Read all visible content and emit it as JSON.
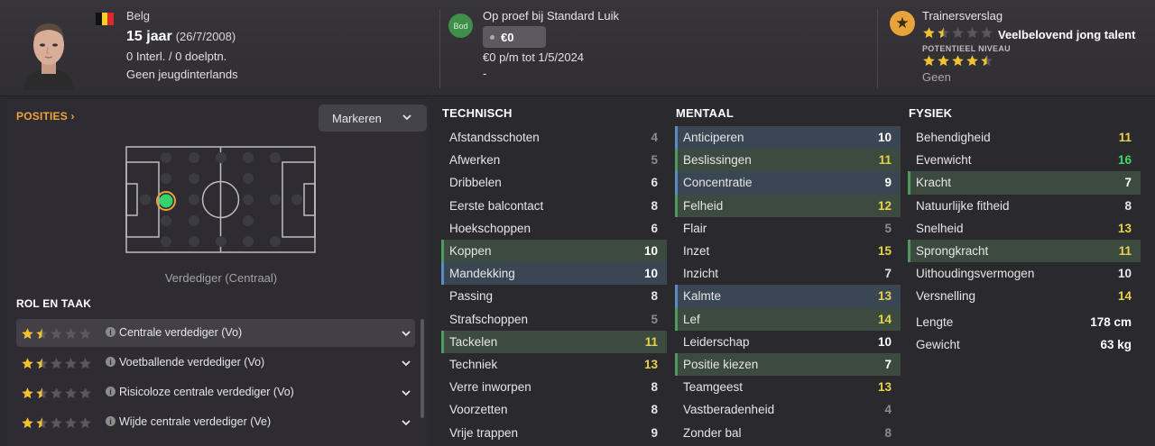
{
  "header": {
    "nationality": "Belg",
    "flag_colors": [
      "#111111",
      "#f5d21f",
      "#e0262b"
    ],
    "age": "15 jaar",
    "birthdate": "(26/7/2008)",
    "caps": "0 Interl. / 0 doelptn.",
    "youth_caps": "Geen jeugdinterlands",
    "bid_badge": "Bod",
    "status": "Op proef bij Standard Luik",
    "fee": "€0",
    "wage": "€0 p/m tot 1/5/2024",
    "dash": "-",
    "report_title": "Trainersverslag",
    "current_stars": 1.5,
    "verdict": "Veelbelovend jong talent",
    "potential_label": "POTENTIEEL NIVEAU",
    "potential_stars": 4.5,
    "potential_note": "Geen"
  },
  "positions": {
    "title": "POSITIES",
    "title_icon": "chevron-right-icon",
    "mark_button": "Markeren",
    "caption": "Verdediger (Centraal)"
  },
  "roles": {
    "title": "ROL EN TAAK",
    "items": [
      {
        "label": "Centrale verdediger (Vo)",
        "stars": 1.5,
        "selected": true
      },
      {
        "label": "Voetballende verdediger (Vo)",
        "stars": 1.5,
        "selected": false
      },
      {
        "label": "Risicoloze centrale verdediger (Vo)",
        "stars": 1.5,
        "selected": false
      },
      {
        "label": "Wijde centrale verdediger (Ve)",
        "stars": 1.5,
        "selected": false
      }
    ]
  },
  "technical": {
    "title": "TECHNISCH",
    "attrs": [
      {
        "name": "Afstandsschoten",
        "value": "4",
        "color": "#8c8c8c",
        "hl": ""
      },
      {
        "name": "Afwerken",
        "value": "5",
        "color": "#8c8c8c",
        "hl": ""
      },
      {
        "name": "Dribbelen",
        "value": "6",
        "color": "#e6e6e6",
        "hl": ""
      },
      {
        "name": "Eerste balcontact",
        "value": "8",
        "color": "#e6e6e6",
        "hl": ""
      },
      {
        "name": "Hoekschoppen",
        "value": "6",
        "color": "#e6e6e6",
        "hl": ""
      },
      {
        "name": "Koppen",
        "value": "10",
        "color": "#ffffff",
        "hl": "green"
      },
      {
        "name": "Mandekking",
        "value": "10",
        "color": "#ffffff",
        "hl": "blue"
      },
      {
        "name": "Passing",
        "value": "8",
        "color": "#e6e6e6",
        "hl": ""
      },
      {
        "name": "Strafschoppen",
        "value": "5",
        "color": "#8c8c8c",
        "hl": ""
      },
      {
        "name": "Tackelen",
        "value": "11",
        "color": "#e8d44a",
        "hl": "green"
      },
      {
        "name": "Techniek",
        "value": "13",
        "color": "#e8d44a",
        "hl": ""
      },
      {
        "name": "Verre inworpen",
        "value": "8",
        "color": "#e6e6e6",
        "hl": ""
      },
      {
        "name": "Voorzetten",
        "value": "8",
        "color": "#e6e6e6",
        "hl": ""
      },
      {
        "name": "Vrije trappen",
        "value": "9",
        "color": "#e6e6e6",
        "hl": ""
      }
    ]
  },
  "mental": {
    "title": "MENTAAL",
    "attrs": [
      {
        "name": "Anticiperen",
        "value": "10",
        "color": "#ffffff",
        "hl": "blue"
      },
      {
        "name": "Beslissingen",
        "value": "11",
        "color": "#e8d44a",
        "hl": "green"
      },
      {
        "name": "Concentratie",
        "value": "9",
        "color": "#ffffff",
        "hl": "blue"
      },
      {
        "name": "Felheid",
        "value": "12",
        "color": "#e8d44a",
        "hl": "green"
      },
      {
        "name": "Flair",
        "value": "5",
        "color": "#8c8c8c",
        "hl": ""
      },
      {
        "name": "Inzet",
        "value": "15",
        "color": "#e8d44a",
        "hl": ""
      },
      {
        "name": "Inzicht",
        "value": "7",
        "color": "#e6e6e6",
        "hl": ""
      },
      {
        "name": "Kalmte",
        "value": "13",
        "color": "#e8d44a",
        "hl": "blue"
      },
      {
        "name": "Lef",
        "value": "14",
        "color": "#e8d44a",
        "hl": "green"
      },
      {
        "name": "Leiderschap",
        "value": "10",
        "color": "#ffffff",
        "hl": ""
      },
      {
        "name": "Positie kiezen",
        "value": "7",
        "color": "#ffffff",
        "hl": "green"
      },
      {
        "name": "Teamgeest",
        "value": "13",
        "color": "#e8d44a",
        "hl": ""
      },
      {
        "name": "Vastberadenheid",
        "value": "4",
        "color": "#8c8c8c",
        "hl": ""
      },
      {
        "name": "Zonder bal",
        "value": "8",
        "color": "#8c8c8c",
        "hl": ""
      }
    ]
  },
  "physical": {
    "title": "FYSIEK",
    "attrs": [
      {
        "name": "Behendigheid",
        "value": "11",
        "color": "#e8d44a",
        "hl": ""
      },
      {
        "name": "Evenwicht",
        "value": "16",
        "color": "#3fd66a",
        "hl": ""
      },
      {
        "name": "Kracht",
        "value": "7",
        "color": "#ffffff",
        "hl": "green"
      },
      {
        "name": "Natuurlijke fitheid",
        "value": "8",
        "color": "#e6e6e6",
        "hl": ""
      },
      {
        "name": "Snelheid",
        "value": "13",
        "color": "#e8d44a",
        "hl": ""
      },
      {
        "name": "Sprongkracht",
        "value": "11",
        "color": "#e8d44a",
        "hl": "green"
      },
      {
        "name": "Uithoudingsvermogen",
        "value": "10",
        "color": "#e6e6e6",
        "hl": ""
      },
      {
        "name": "Versnelling",
        "value": "14",
        "color": "#e8d44a",
        "hl": ""
      }
    ],
    "info": [
      {
        "name": "Lengte",
        "value": "178 cm"
      },
      {
        "name": "Gewicht",
        "value": "63 kg"
      }
    ]
  }
}
